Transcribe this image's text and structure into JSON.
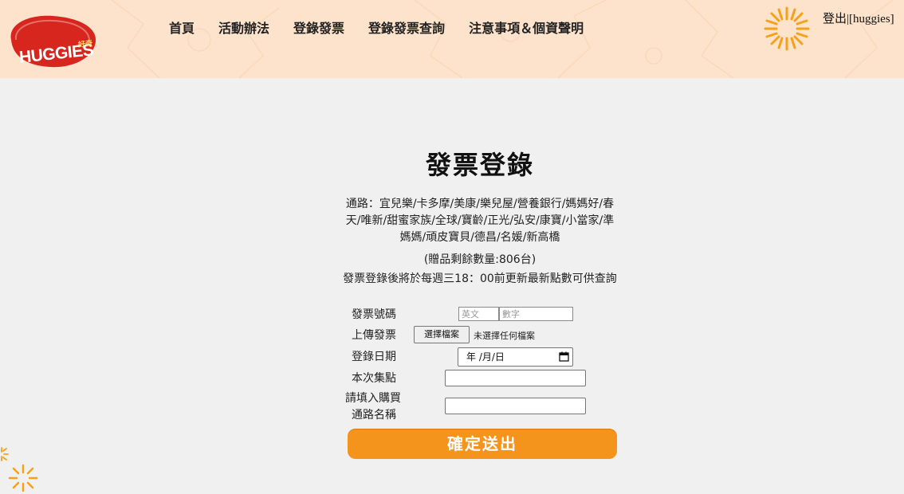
{
  "header": {
    "logo_text": "HUGGIES",
    "logo_sub": "好奇",
    "nav": [
      {
        "label": "首頁"
      },
      {
        "label": "活動辦法"
      },
      {
        "label": "登錄發票"
      },
      {
        "label": "登錄發票查詢"
      },
      {
        "label": "注意事項＆個資聲明"
      }
    ],
    "logout_label": "登出",
    "user_label": "|[huggies]"
  },
  "colors": {
    "header_bg": "#fde3cc",
    "accent_orange": "#f5941d",
    "logo_red": "#d7261e"
  },
  "form": {
    "title": "發票登錄",
    "channels": "通路：宜兒樂/卡多摩/美康/樂兒屋/營養銀行/媽媽好/春天/唯新/甜蜜家族/全球/寶齡/正光/弘安/康寶/小當家/準媽媽/頑皮寶貝/德昌/名媛/新高橋",
    "stock": "(贈品剩餘數量:806台)",
    "notice": "發票登錄後將於每週三18：00前更新最新點數可供查詢",
    "invoice_label": "發票號碼",
    "invoice_letters_placeholder": "英文",
    "invoice_digits_placeholder": "數字",
    "upload_label": "上傳發票",
    "upload_button": "選擇檔案",
    "upload_status": "未選擇任何檔案",
    "date_label": "登錄日期",
    "date_value": "年 /月/日",
    "points_label": "本次集點",
    "channel_name_label_line1": "請填入購買",
    "channel_name_label_line2": "通路名稱",
    "submit_label": "確定送出"
  },
  "icons": {
    "logo": "huggies-logo",
    "burst": "sunburst-icon",
    "calendar": "calendar-icon"
  }
}
